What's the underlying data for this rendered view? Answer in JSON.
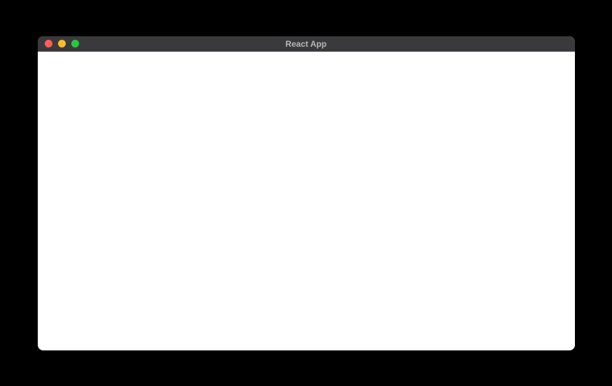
{
  "window": {
    "title": "React App"
  }
}
